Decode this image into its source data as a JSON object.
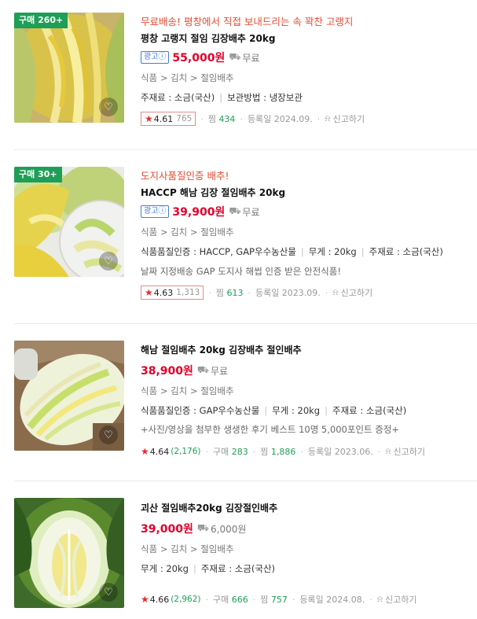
{
  "products": [
    {
      "badge": "구매 260+",
      "promo": "무료배송! 평창에서 직접 보내드리는 속 꽉찬 고랭지",
      "title": "평창 고랭지 절임 김장배추 20kg",
      "ad_label": "광고ⓘ",
      "price": "55,000원",
      "shipping": "무료",
      "category": "식품 > 김치 > 절임배추",
      "attrs": [
        "주재료 : 소금(국산)",
        "보관방법 : 냉장보관"
      ],
      "desc": "",
      "rating": "4.61",
      "review_count": "765",
      "purchase_label": "",
      "purchase_count": "",
      "zzim_label": "찜",
      "zzim_count": "434",
      "registered": "등록일 2024.09.",
      "report": "신고하기"
    },
    {
      "badge": "구매 30+",
      "promo": "도지사품질인증 배추!",
      "title": "HACCP 해남 김장 절임배추 20kg",
      "ad_label": "광고ⓘ",
      "price": "39,900원",
      "shipping": "무료",
      "category": "식품 > 김치 > 절임배추",
      "attrs": [
        "식품품질인증 : HACCP, GAP우수농산물",
        "무게 : 20kg",
        "주재료 : 소금(국산)"
      ],
      "desc": "날짜 지정배송 GAP 도지사 해썹 인증 받은 안전식품!",
      "rating": "4.63",
      "review_count": "1,313",
      "purchase_label": "",
      "purchase_count": "",
      "zzim_label": "찜",
      "zzim_count": "613",
      "registered": "등록일 2023.09.",
      "report": "신고하기"
    },
    {
      "badge": "",
      "promo": "",
      "title": "해남 절임배추 20kg 김장배추 절인배추",
      "ad_label": "",
      "price": "38,900원",
      "shipping": "무료",
      "category": "식품 > 김치 > 절임배추",
      "attrs": [
        "식품품질인증 : GAP우수농산물",
        "무게 : 20kg",
        "주재료 : 소금(국산)"
      ],
      "desc": "+사진/영상을 첨부한 생생한 후기 베스트 10명 5,000포인트 증정+",
      "rating": "4.64",
      "review_count": "(2,176)",
      "purchase_label": "구매",
      "purchase_count": "283",
      "zzim_label": "찜",
      "zzim_count": "1,886",
      "registered": "등록일 2023.06.",
      "report": "신고하기"
    },
    {
      "badge": "",
      "promo": "",
      "title": "괴산 절임배추20kg 김장절인배추",
      "ad_label": "",
      "price": "39,000원",
      "shipping": "6,000원",
      "category": "식품 > 김치 > 절임배추",
      "attrs": [
        "무게 : 20kg",
        "주재료 : 소금(국산)"
      ],
      "desc": "",
      "rating": "4.66",
      "review_count": "(2,962)",
      "purchase_label": "구매",
      "purchase_count": "666",
      "zzim_label": "찜",
      "zzim_count": "757",
      "registered": "등록일 2024.08.",
      "report": "신고하기"
    }
  ],
  "icons": {
    "truck": "truck-icon",
    "heart": "heart-icon",
    "star": "star-icon",
    "report": "siren-icon"
  },
  "colors": {
    "price": "#e0002a",
    "promo": "#e54c35",
    "badge": "#1f9e57",
    "ad": "#3f7de0"
  }
}
